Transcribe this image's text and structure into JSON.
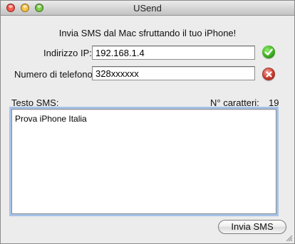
{
  "window": {
    "title": "USend"
  },
  "main": {
    "heading": "Invia SMS dal Mac sfruttando il tuo iPhone!",
    "ip": {
      "label": "Indirizzo IP:",
      "value": "192.168.1.4",
      "status_icon": "check-icon"
    },
    "phone": {
      "label": "Numero di telefono:",
      "value": "328xxxxxx",
      "status_icon": "error-icon"
    },
    "sms": {
      "label": "Testo SMS:",
      "char_count_label": "N° caratteri:",
      "char_count": "19",
      "text": "Prova iPhone Italia"
    },
    "send_button_label": "Invia SMS"
  },
  "colors": {
    "ok": "#2d9a12",
    "error": "#c93527",
    "focus_ring": "#a6c3e8"
  }
}
